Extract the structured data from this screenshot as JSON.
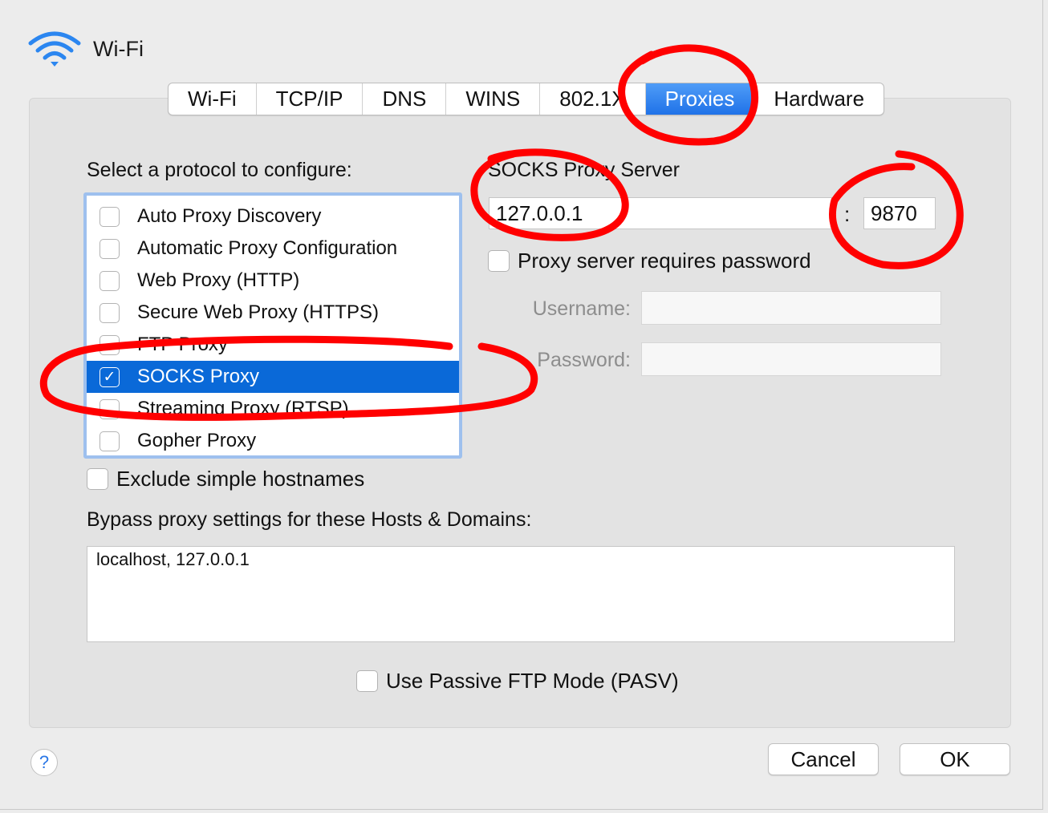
{
  "window": {
    "title": "Wi-Fi"
  },
  "tabs": [
    {
      "label": "Wi-Fi"
    },
    {
      "label": "TCP/IP"
    },
    {
      "label": "DNS"
    },
    {
      "label": "WINS"
    },
    {
      "label": "802.1X"
    },
    {
      "label": "Proxies"
    },
    {
      "label": "Hardware"
    }
  ],
  "active_tab": "Proxies",
  "protocols": {
    "heading": "Select a protocol to configure:",
    "items": [
      {
        "label": "Auto Proxy Discovery",
        "checked": false
      },
      {
        "label": "Automatic Proxy Configuration",
        "checked": false
      },
      {
        "label": "Web Proxy (HTTP)",
        "checked": false
      },
      {
        "label": "Secure Web Proxy (HTTPS)",
        "checked": false
      },
      {
        "label": "FTP Proxy",
        "checked": false
      },
      {
        "label": "SOCKS Proxy",
        "checked": true
      },
      {
        "label": "Streaming Proxy (RTSP)",
        "checked": false
      },
      {
        "label": "Gopher Proxy",
        "checked": false
      }
    ],
    "selected": "SOCKS Proxy"
  },
  "server": {
    "heading": "SOCKS Proxy Server",
    "host": "127.0.0.1",
    "separator": ":",
    "port": "9870",
    "requires_password_label": "Proxy server requires password",
    "username_label": "Username:",
    "password_label": "Password:",
    "username": "",
    "password": ""
  },
  "exclude_simple_hostnames_label": "Exclude simple hostnames",
  "bypass": {
    "heading": "Bypass proxy settings for these Hosts & Domains:",
    "value": "localhost, 127.0.0.1"
  },
  "passive_ftp_label": "Use Passive FTP Mode (PASV)",
  "buttons": {
    "help": "?",
    "cancel": "Cancel",
    "ok": "OK"
  },
  "checkmark": "✓",
  "colors": {
    "accent": "#0a69d8",
    "tab_active": "#2a7ff0",
    "annotation": "#ff0000"
  }
}
